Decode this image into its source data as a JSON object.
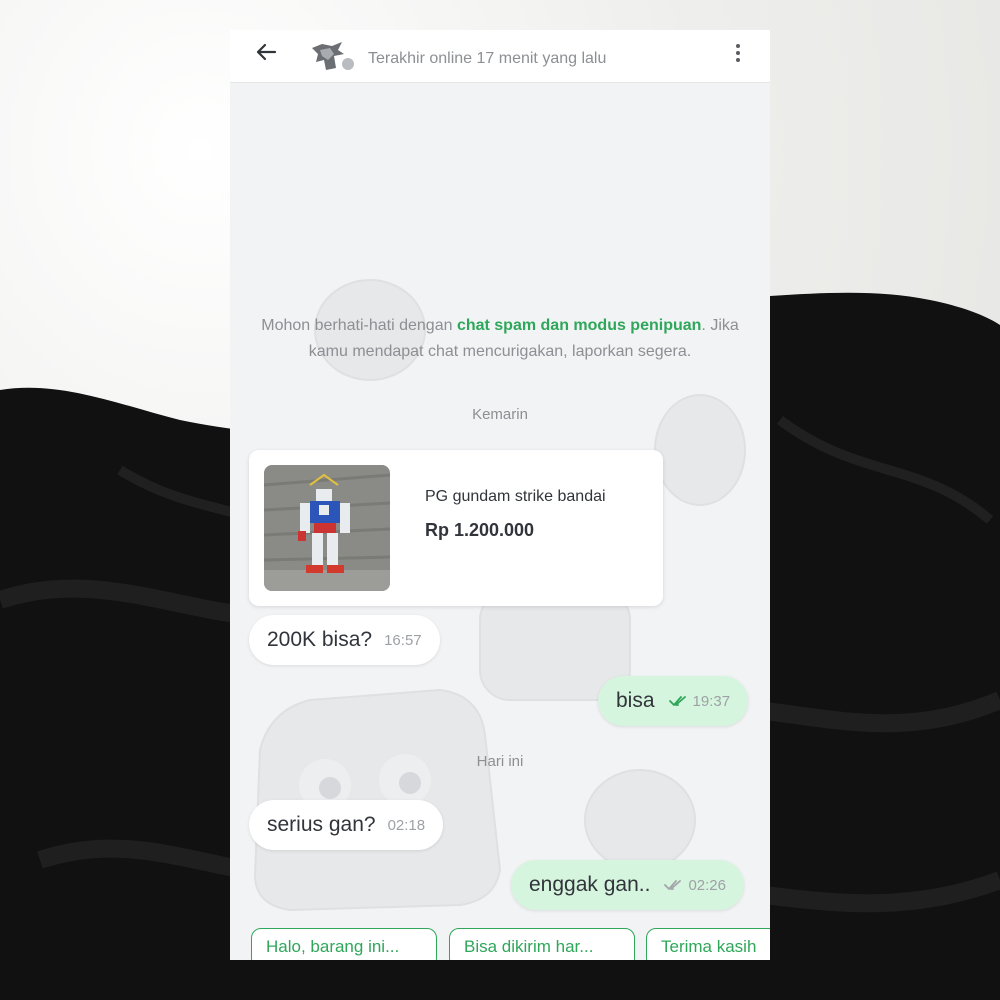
{
  "header": {
    "status": "Terakhir online 17 menit yang lalu"
  },
  "icons": {
    "back": "arrow-left-icon",
    "menu": "kebab-menu-icon",
    "read": "double-check-icon"
  },
  "colors": {
    "accent": "#2fa75a",
    "outgoing_bubble": "#d6f5de",
    "incoming_bubble": "#ffffff",
    "chat_background": "#f2f3f5"
  },
  "warning": {
    "before": "Mohon berhati-hati dengan ",
    "highlight": "chat spam dan modus penipuan",
    "after": ". Jika kamu mendapat chat mencurigakan, laporkan segera."
  },
  "separators": {
    "yesterday": "Kemarin",
    "today": "Hari ini"
  },
  "product": {
    "name": "PG gundam strike bandai",
    "price": "Rp 1.200.000"
  },
  "messages": [
    {
      "direction": "in",
      "text": "200K bisa?",
      "time": "16:57"
    },
    {
      "direction": "out",
      "text": "bisa",
      "time": "19:37"
    },
    {
      "direction": "in",
      "text": "serius gan?",
      "time": "02:18"
    },
    {
      "direction": "out",
      "text": "enggak gan..",
      "time": "02:26"
    }
  ],
  "quick_replies": [
    "Halo, barang ini...",
    "Bisa dikirim har...",
    "Terima kasih"
  ]
}
